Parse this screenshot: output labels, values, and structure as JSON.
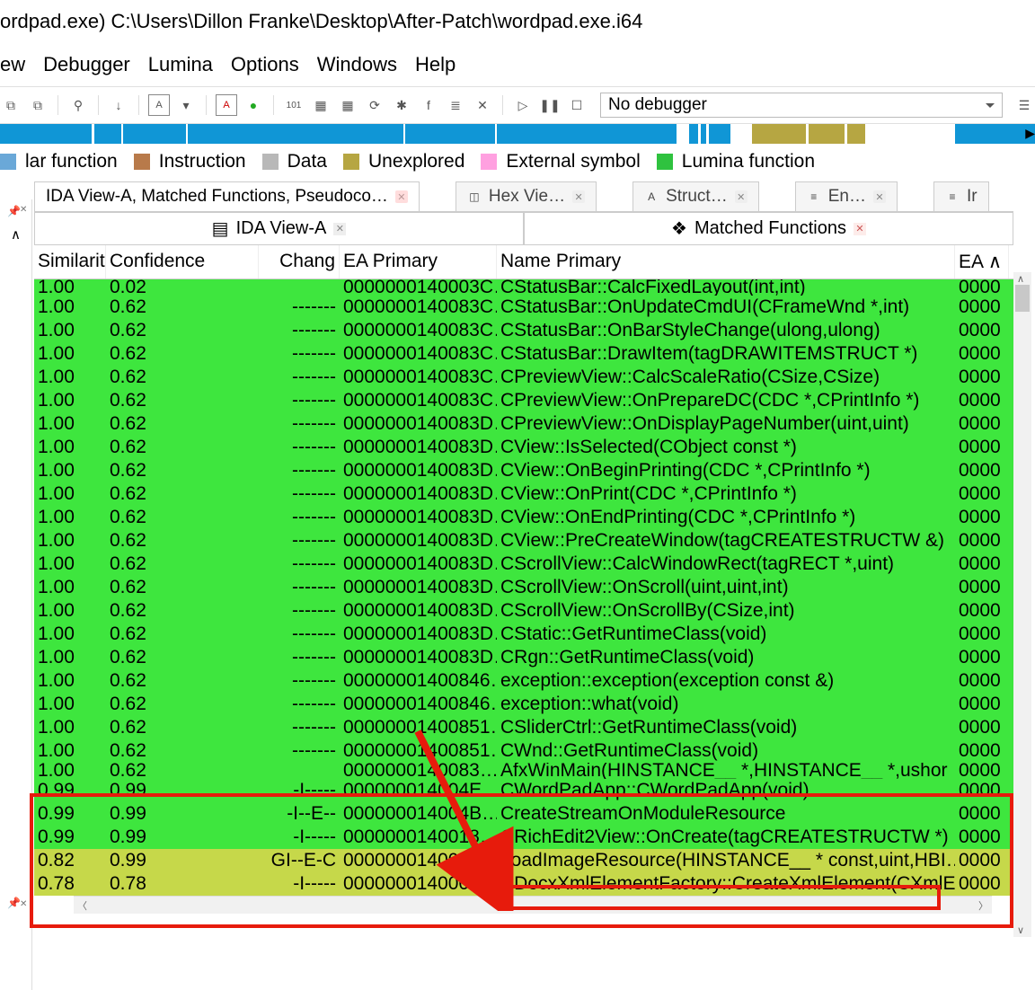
{
  "title": "ordpad.exe) C:\\Users\\Dillon Franke\\Desktop\\After-Patch\\wordpad.exe.i64",
  "menu": [
    "ew",
    "Debugger",
    "Lumina",
    "Options",
    "Windows",
    "Help"
  ],
  "debugger_dropdown": "No debugger",
  "legend": [
    {
      "label": "lar function",
      "color": "#6aa8d8"
    },
    {
      "label": "Instruction",
      "color": "#b87a4a"
    },
    {
      "label": "Data",
      "color": "#b8b8b8"
    },
    {
      "label": "Unexplored",
      "color": "#b6a642"
    },
    {
      "label": "External symbol",
      "color": "#ffa0e0"
    },
    {
      "label": "Lumina function",
      "color": "#2fc23f"
    }
  ],
  "tabs_row1": [
    {
      "label": "IDA View-A, Matched Functions, Pseudoco…",
      "close": "red"
    },
    {
      "label": "Hex Vie…",
      "close": "gray",
      "icon": "◫"
    },
    {
      "label": "Struct…",
      "close": "gray",
      "icon": "A"
    },
    {
      "label": "En…",
      "close": "gray",
      "icon": "≡"
    },
    {
      "label": "Ir",
      "icon": "≡"
    }
  ],
  "subtabs": [
    {
      "label": "IDA View-A",
      "close": "gray",
      "icon": "▤"
    },
    {
      "label": "Matched Functions",
      "close": "red",
      "icon": "❖"
    }
  ],
  "columns": [
    "Similarit",
    "Confidence",
    "Chang",
    "EA Primary",
    "Name Primary",
    "EA"
  ],
  "rows_top_cut": {
    "sim": "1.00",
    "conf": "0.02",
    "chg": "",
    "ea": "0000000140003C…",
    "name": "CStatusBar::CalcFixedLayout(int,int)",
    "ea2": "0000"
  },
  "rows": [
    {
      "sim": "1.00",
      "conf": "0.62",
      "chg": "-------",
      "ea": "0000000140083C…",
      "name": "CStatusBar::OnUpdateCmdUI(CFrameWnd *,int)",
      "ea2": "0000"
    },
    {
      "sim": "1.00",
      "conf": "0.62",
      "chg": "-------",
      "ea": "0000000140083C…",
      "name": "CStatusBar::OnBarStyleChange(ulong,ulong)",
      "ea2": "0000"
    },
    {
      "sim": "1.00",
      "conf": "0.62",
      "chg": "-------",
      "ea": "0000000140083C…",
      "name": "CStatusBar::DrawItem(tagDRAWITEMSTRUCT *)",
      "ea2": "0000"
    },
    {
      "sim": "1.00",
      "conf": "0.62",
      "chg": "-------",
      "ea": "0000000140083C…",
      "name": "CPreviewView::CalcScaleRatio(CSize,CSize)",
      "ea2": "0000"
    },
    {
      "sim": "1.00",
      "conf": "0.62",
      "chg": "-------",
      "ea": "0000000140083C…",
      "name": "CPreviewView::OnPrepareDC(CDC *,CPrintInfo *)",
      "ea2": "0000"
    },
    {
      "sim": "1.00",
      "conf": "0.62",
      "chg": "-------",
      "ea": "0000000140083D…",
      "name": "CPreviewView::OnDisplayPageNumber(uint,uint)",
      "ea2": "0000"
    },
    {
      "sim": "1.00",
      "conf": "0.62",
      "chg": "-------",
      "ea": "0000000140083D…",
      "name": "CView::IsSelected(CObject const *)",
      "ea2": "0000"
    },
    {
      "sim": "1.00",
      "conf": "0.62",
      "chg": "-------",
      "ea": "0000000140083D…",
      "name": "CView::OnBeginPrinting(CDC *,CPrintInfo *)",
      "ea2": "0000"
    },
    {
      "sim": "1.00",
      "conf": "0.62",
      "chg": "-------",
      "ea": "0000000140083D…",
      "name": "CView::OnPrint(CDC *,CPrintInfo *)",
      "ea2": "0000"
    },
    {
      "sim": "1.00",
      "conf": "0.62",
      "chg": "-------",
      "ea": "0000000140083D…",
      "name": "CView::OnEndPrinting(CDC *,CPrintInfo *)",
      "ea2": "0000"
    },
    {
      "sim": "1.00",
      "conf": "0.62",
      "chg": "-------",
      "ea": "0000000140083D…",
      "name": "CView::PreCreateWindow(tagCREATESTRUCTW &)",
      "ea2": "0000"
    },
    {
      "sim": "1.00",
      "conf": "0.62",
      "chg": "-------",
      "ea": "0000000140083D…",
      "name": "CScrollView::CalcWindowRect(tagRECT *,uint)",
      "ea2": "0000"
    },
    {
      "sim": "1.00",
      "conf": "0.62",
      "chg": "-------",
      "ea": "0000000140083D…",
      "name": "CScrollView::OnScroll(uint,uint,int)",
      "ea2": "0000"
    },
    {
      "sim": "1.00",
      "conf": "0.62",
      "chg": "-------",
      "ea": "0000000140083D…",
      "name": "CScrollView::OnScrollBy(CSize,int)",
      "ea2": "0000"
    },
    {
      "sim": "1.00",
      "conf": "0.62",
      "chg": "-------",
      "ea": "0000000140083D…",
      "name": "CStatic::GetRuntimeClass(void)",
      "ea2": "0000"
    },
    {
      "sim": "1.00",
      "conf": "0.62",
      "chg": "-------",
      "ea": "0000000140083D…",
      "name": "CRgn::GetRuntimeClass(void)",
      "ea2": "0000"
    },
    {
      "sim": "1.00",
      "conf": "0.62",
      "chg": "-------",
      "ea": "00000001400846…",
      "name": "exception::exception(exception const &)",
      "ea2": "0000"
    },
    {
      "sim": "1.00",
      "conf": "0.62",
      "chg": "-------",
      "ea": "00000001400846…",
      "name": "exception::what(void)",
      "ea2": "0000"
    },
    {
      "sim": "1.00",
      "conf": "0.62",
      "chg": "-------",
      "ea": "00000001400851…",
      "name": "CSliderCtrl::GetRuntimeClass(void)",
      "ea2": "0000"
    },
    {
      "sim": "1.00",
      "conf": "0.62",
      "chg": "-------",
      "ea": "00000001400851…",
      "name": "CWnd::GetRuntimeClass(void)",
      "ea2": "0000"
    }
  ],
  "rows_mid_cut": {
    "sim": "1.00",
    "conf": "0.62",
    "chg": "",
    "ea": "0000000140083…",
    "name": "AfxWinMain(HINSTANCE__ *,HINSTANCE__ *,ushor",
    "ea2": "0000"
  },
  "rows_highlight": [
    {
      "sim": "0.99",
      "conf": "0.99",
      "chg": "-I-----",
      "ea": "000000014004E…",
      "name": "CWordPadApp::CWordPadApp(void)",
      "ea2": "0000",
      "cls": ""
    },
    {
      "sim": "0.99",
      "conf": "0.99",
      "chg": "-I--E--",
      "ea": "000000014004B…",
      "name": "CreateStreamOnModuleResource",
      "ea2": "0000",
      "cls": ""
    },
    {
      "sim": "0.99",
      "conf": "0.99",
      "chg": "-I-----",
      "ea": "0000000140018…",
      "name": "CRichEdit2View::OnCreate(tagCREATESTRUCTW *)",
      "ea2": "0000",
      "cls": ""
    },
    {
      "sim": "0.82",
      "conf": "0.99",
      "chg": "GI--E-C",
      "ea": "0000000140068E…",
      "name": "LoadImageResource(HINSTANCE__ * const,uint,HBI…",
      "ea2": "0000",
      "cls": "yellow"
    },
    {
      "sim": "0.78",
      "conf": "0.78",
      "chg": "-I-----",
      "ea": "000000014000D8…",
      "name": "CDocxXmlElementFactory::CreateXmlElement(CXmlE…",
      "ea2": "0000",
      "cls": "yellow"
    }
  ]
}
